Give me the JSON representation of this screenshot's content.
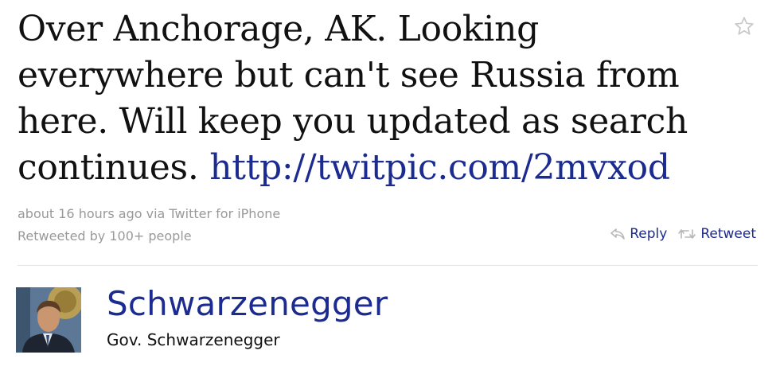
{
  "tweet": {
    "text": "Over Anchorage, AK. Looking everywhere but can't see Russia from here. Will keep you updated as search continues. ",
    "link": "http://twitpic.com/2mvxod"
  },
  "meta": {
    "timestamp_source": "about 16 hours ago via Twitter for iPhone",
    "retweeted_by": "Retweeted by 100+ people"
  },
  "actions": {
    "reply_label": "Reply",
    "retweet_label": "Retweet"
  },
  "author": {
    "screen_name": "Schwarzenegger",
    "full_name": "Gov. Schwarzenegger"
  },
  "icons": {
    "favorite": "star-icon",
    "reply": "reply-arrow-icon",
    "retweet": "retweet-arrows-icon",
    "avatar": "avatar"
  },
  "colors": {
    "link": "#1c2b8f",
    "meta_text": "#999999",
    "tweet_text": "#111111"
  }
}
